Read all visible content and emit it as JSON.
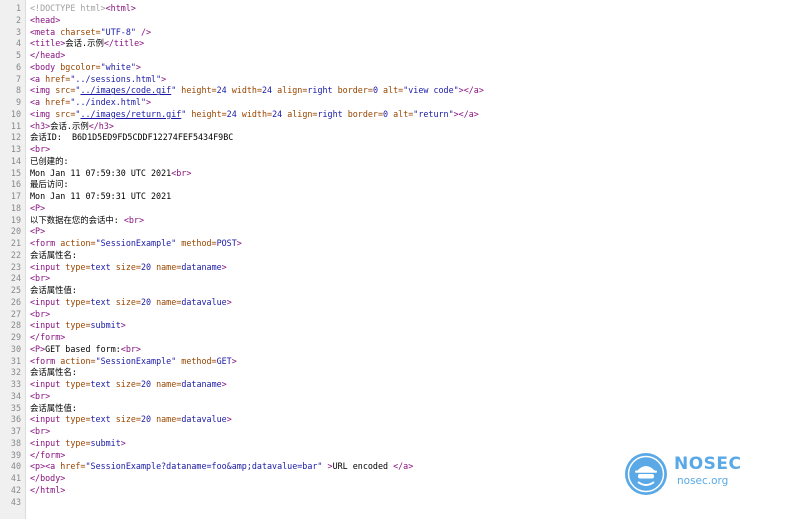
{
  "viewer": {
    "lines": [
      [
        {
          "t": "doctype",
          "v": "<!DOCTYPE html>"
        },
        {
          "t": "tag",
          "v": "<html>"
        }
      ],
      [
        {
          "t": "tag",
          "v": "<head>"
        }
      ],
      [
        {
          "t": "tag",
          "v": "<meta "
        },
        {
          "t": "attr",
          "v": "charset="
        },
        {
          "t": "val",
          "v": "\"UTF-8\""
        },
        {
          "t": "tag",
          "v": " />"
        }
      ],
      [
        {
          "t": "tag",
          "v": "<title>"
        },
        {
          "t": "text",
          "v": "会话.示例"
        },
        {
          "t": "tag",
          "v": "</title>"
        }
      ],
      [
        {
          "t": "tag",
          "v": "</head>"
        }
      ],
      [
        {
          "t": "tag",
          "v": "<body "
        },
        {
          "t": "attr",
          "v": "bgcolor="
        },
        {
          "t": "val",
          "v": "\"white\""
        },
        {
          "t": "tag",
          "v": ">"
        }
      ],
      [
        {
          "t": "tag",
          "v": "<a "
        },
        {
          "t": "attr",
          "v": "href="
        },
        {
          "t": "val",
          "v": "\"../sessions.html\""
        },
        {
          "t": "tag",
          "v": ">"
        }
      ],
      [
        {
          "t": "tag",
          "v": "<img "
        },
        {
          "t": "attr",
          "v": "src="
        },
        {
          "t": "val",
          "v": "\""
        },
        {
          "t": "link",
          "v": "../images/code.gif"
        },
        {
          "t": "val",
          "v": "\""
        },
        {
          "t": "attr",
          "v": " height="
        },
        {
          "t": "val",
          "v": "24"
        },
        {
          "t": "attr",
          "v": " width="
        },
        {
          "t": "val",
          "v": "24"
        },
        {
          "t": "attr",
          "v": " align="
        },
        {
          "t": "val",
          "v": "right"
        },
        {
          "t": "attr",
          "v": " border="
        },
        {
          "t": "val",
          "v": "0"
        },
        {
          "t": "attr",
          "v": " alt="
        },
        {
          "t": "val",
          "v": "\"view code\""
        },
        {
          "t": "tag",
          "v": "></a>"
        }
      ],
      [
        {
          "t": "tag",
          "v": "<a "
        },
        {
          "t": "attr",
          "v": "href="
        },
        {
          "t": "val",
          "v": "\"../index.html\""
        },
        {
          "t": "tag",
          "v": ">"
        }
      ],
      [
        {
          "t": "tag",
          "v": "<img "
        },
        {
          "t": "attr",
          "v": "src="
        },
        {
          "t": "val",
          "v": "\""
        },
        {
          "t": "link",
          "v": "../images/return.gif"
        },
        {
          "t": "val",
          "v": "\""
        },
        {
          "t": "attr",
          "v": " height="
        },
        {
          "t": "val",
          "v": "24"
        },
        {
          "t": "attr",
          "v": " width="
        },
        {
          "t": "val",
          "v": "24"
        },
        {
          "t": "attr",
          "v": " align="
        },
        {
          "t": "val",
          "v": "right"
        },
        {
          "t": "attr",
          "v": " border="
        },
        {
          "t": "val",
          "v": "0"
        },
        {
          "t": "attr",
          "v": " alt="
        },
        {
          "t": "val",
          "v": "\"return\""
        },
        {
          "t": "tag",
          "v": "></a>"
        }
      ],
      [
        {
          "t": "tag",
          "v": "<h3>"
        },
        {
          "t": "text",
          "v": "会话.示例"
        },
        {
          "t": "tag",
          "v": "</h3>"
        }
      ],
      [
        {
          "t": "text",
          "v": "会话ID:  B6D1D5ED9FD5CDDF12274FEF5434F9BC"
        }
      ],
      [
        {
          "t": "tag",
          "v": "<br>"
        }
      ],
      [
        {
          "t": "text",
          "v": "已创建的:"
        }
      ],
      [
        {
          "t": "text",
          "v": "Mon Jan 11 07:59:30 UTC 2021"
        },
        {
          "t": "tag",
          "v": "<br>"
        }
      ],
      [
        {
          "t": "text",
          "v": "最后访问:"
        }
      ],
      [
        {
          "t": "text",
          "v": "Mon Jan 11 07:59:31 UTC 2021"
        }
      ],
      [
        {
          "t": "tag",
          "v": "<P>"
        }
      ],
      [
        {
          "t": "text",
          "v": "以下数据在您的会话中: "
        },
        {
          "t": "tag",
          "v": "<br>"
        }
      ],
      [
        {
          "t": "tag",
          "v": "<P>"
        }
      ],
      [
        {
          "t": "tag",
          "v": "<form "
        },
        {
          "t": "attr",
          "v": "action="
        },
        {
          "t": "val",
          "v": "\"SessionExample\""
        },
        {
          "t": "attr",
          "v": " method="
        },
        {
          "t": "val",
          "v": "POST"
        },
        {
          "t": "tag",
          "v": ">"
        }
      ],
      [
        {
          "t": "text",
          "v": "会话属性名:"
        }
      ],
      [
        {
          "t": "tag",
          "v": "<input "
        },
        {
          "t": "attr",
          "v": "type="
        },
        {
          "t": "val",
          "v": "text"
        },
        {
          "t": "attr",
          "v": " size="
        },
        {
          "t": "val",
          "v": "20"
        },
        {
          "t": "attr",
          "v": " name="
        },
        {
          "t": "val",
          "v": "dataname"
        },
        {
          "t": "tag",
          "v": ">"
        }
      ],
      [
        {
          "t": "tag",
          "v": "<br>"
        }
      ],
      [
        {
          "t": "text",
          "v": "会话属性值:"
        }
      ],
      [
        {
          "t": "tag",
          "v": "<input "
        },
        {
          "t": "attr",
          "v": "type="
        },
        {
          "t": "val",
          "v": "text"
        },
        {
          "t": "attr",
          "v": " size="
        },
        {
          "t": "val",
          "v": "20"
        },
        {
          "t": "attr",
          "v": " name="
        },
        {
          "t": "val",
          "v": "datavalue"
        },
        {
          "t": "tag",
          "v": ">"
        }
      ],
      [
        {
          "t": "tag",
          "v": "<br>"
        }
      ],
      [
        {
          "t": "tag",
          "v": "<input "
        },
        {
          "t": "attr",
          "v": "type="
        },
        {
          "t": "val",
          "v": "submit"
        },
        {
          "t": "tag",
          "v": ">"
        }
      ],
      [
        {
          "t": "tag",
          "v": "</form>"
        }
      ],
      [
        {
          "t": "tag",
          "v": "<P>"
        },
        {
          "t": "text",
          "v": "GET based form:"
        },
        {
          "t": "tag",
          "v": "<br>"
        }
      ],
      [
        {
          "t": "tag",
          "v": "<form "
        },
        {
          "t": "attr",
          "v": "action="
        },
        {
          "t": "val",
          "v": "\"SessionExample\""
        },
        {
          "t": "attr",
          "v": " method="
        },
        {
          "t": "val",
          "v": "GET"
        },
        {
          "t": "tag",
          "v": ">"
        }
      ],
      [
        {
          "t": "text",
          "v": "会话属性名:"
        }
      ],
      [
        {
          "t": "tag",
          "v": "<input "
        },
        {
          "t": "attr",
          "v": "type="
        },
        {
          "t": "val",
          "v": "text"
        },
        {
          "t": "attr",
          "v": " size="
        },
        {
          "t": "val",
          "v": "20"
        },
        {
          "t": "attr",
          "v": " name="
        },
        {
          "t": "val",
          "v": "dataname"
        },
        {
          "t": "tag",
          "v": ">"
        }
      ],
      [
        {
          "t": "tag",
          "v": "<br>"
        }
      ],
      [
        {
          "t": "text",
          "v": "会话属性值:"
        }
      ],
      [
        {
          "t": "tag",
          "v": "<input "
        },
        {
          "t": "attr",
          "v": "type="
        },
        {
          "t": "val",
          "v": "text"
        },
        {
          "t": "attr",
          "v": " size="
        },
        {
          "t": "val",
          "v": "20"
        },
        {
          "t": "attr",
          "v": " name="
        },
        {
          "t": "val",
          "v": "datavalue"
        },
        {
          "t": "tag",
          "v": ">"
        }
      ],
      [
        {
          "t": "tag",
          "v": "<br>"
        }
      ],
      [
        {
          "t": "tag",
          "v": "<input "
        },
        {
          "t": "attr",
          "v": "type="
        },
        {
          "t": "val",
          "v": "submit"
        },
        {
          "t": "tag",
          "v": ">"
        }
      ],
      [
        {
          "t": "tag",
          "v": "</form>"
        }
      ],
      [
        {
          "t": "tag",
          "v": "<p><a "
        },
        {
          "t": "attr",
          "v": "href="
        },
        {
          "t": "val",
          "v": "\"SessionExample?dataname=foo&amp;datavalue=bar\""
        },
        {
          "t": "tag",
          "v": " >"
        },
        {
          "t": "text",
          "v": "URL encoded "
        },
        {
          "t": "tag",
          "v": "</a>"
        }
      ],
      [
        {
          "t": "tag",
          "v": "</body>"
        }
      ],
      [
        {
          "t": "tag",
          "v": "</html>"
        }
      ],
      []
    ]
  },
  "watermark": {
    "brand": "NOSEC",
    "site": "nosec.org",
    "color": "#5aa9e6",
    "icon": "agent-mascot-icon"
  },
  "colors": {
    "tag": "#881280",
    "attr": "#994500",
    "value": "#1a1aa6",
    "doctype": "#a0a0a0",
    "gutter": "#f0f0f0"
  }
}
